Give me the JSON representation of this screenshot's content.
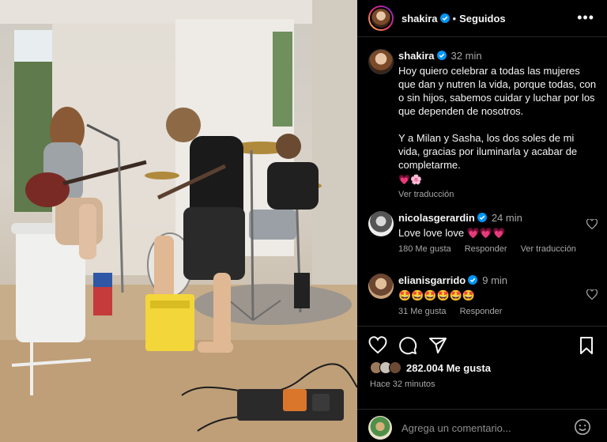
{
  "post": {
    "username": "shakira",
    "follow_label": "Seguidos",
    "more_label": "•••",
    "photo_alt": "Foto de ensayo musical en casa"
  },
  "caption": {
    "username": "shakira",
    "time": "32 min",
    "paragraph1": "Hoy quiero celebrar a todas las mujeres que dan y nutren la vida, porque todas, con o sin hijos, sabemos cuidar y luchar por los que dependen de nosotros.",
    "paragraph2": "Y a Milan y Sasha, los dos soles de mi vida, gracias por iluminarla y acabar de completarme.",
    "hearts": "💗🌸",
    "translate_label": "Ver traducción"
  },
  "comments": [
    {
      "username": "nicolasgerardin",
      "time": "24 min",
      "text": "Love love love 💗💗💗",
      "likes": "180 Me gusta",
      "reply_label": "Responder",
      "translate_label": "Ver traducción"
    },
    {
      "username": "elianisgarrido",
      "time": "9 min",
      "text": "🤩🤩🤩🤩🤩🤩",
      "likes": "31 Me gusta",
      "reply_label": "Responder"
    }
  ],
  "footer": {
    "likes_count": "282.004 Me gusta",
    "posted_ago": "Hace 32 minutos",
    "comment_placeholder": "Agrega un comentario..."
  },
  "colors": {
    "background": "#000000",
    "text": "#f5f5f5",
    "muted": "#a8a8a8",
    "verified": "#0095f6",
    "heart": "#ff3040"
  }
}
